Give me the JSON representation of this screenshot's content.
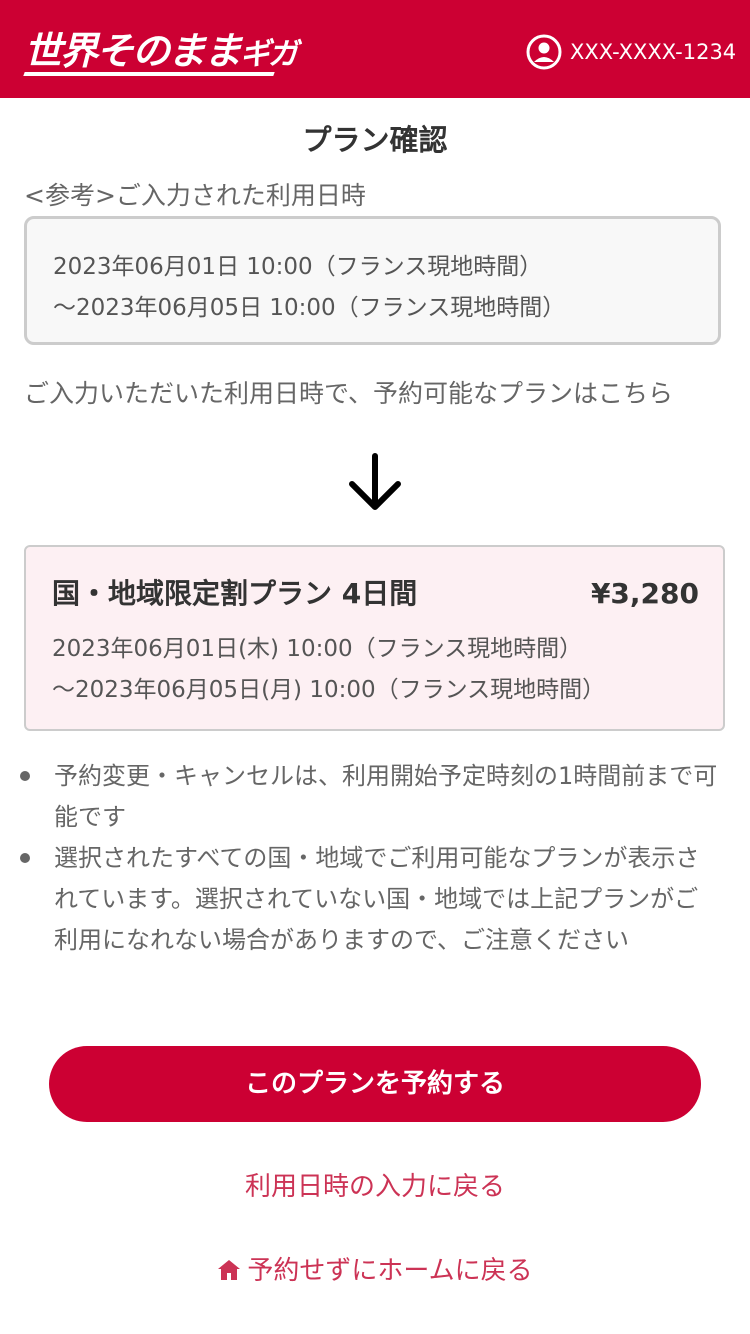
{
  "header": {
    "logo_main": "世界そのまま",
    "logo_end": "ギガ",
    "phone": "XXX-XXXX-1234",
    "icon": "user-circle-icon",
    "bg_color": "#cc0033"
  },
  "title": "プラン確認",
  "reference": {
    "label": "<参考>ご入力された利用日時",
    "start": "2023年06月01日 10:00（フランス現地時間）",
    "end": "～2023年06月05日 10:00（フランス現地時間）"
  },
  "intro": "ご入力いただいた利用日時で、予約可能なプランはこちら",
  "arrow_icon": "arrow-down-icon",
  "plan": {
    "name": "国・地域限定割プラン 4日間",
    "price": "¥3,280",
    "start": "2023年06月01日(木) 10:00（フランス現地時間）",
    "end": "～2023年06月05日(月) 10:00（フランス現地時間）"
  },
  "notes": [
    "予約変更・キャンセルは、利用開始予定時刻の1時間前まで可能です",
    "選択されたすべての国・地域でご利用可能なプランが表示されています。選択されていない国・地域では上記プランがご利用になれない場合がありますので、ご注意ください"
  ],
  "actions": {
    "reserve_label": "このプランを予約する",
    "back_label": "利用日時の入力に戻る",
    "home_label": "予約せずにホームに戻る",
    "home_icon": "home-icon"
  },
  "colors": {
    "accent": "#cc0033",
    "link": "#cc3355",
    "plan_bg": "#fdf0f3"
  }
}
